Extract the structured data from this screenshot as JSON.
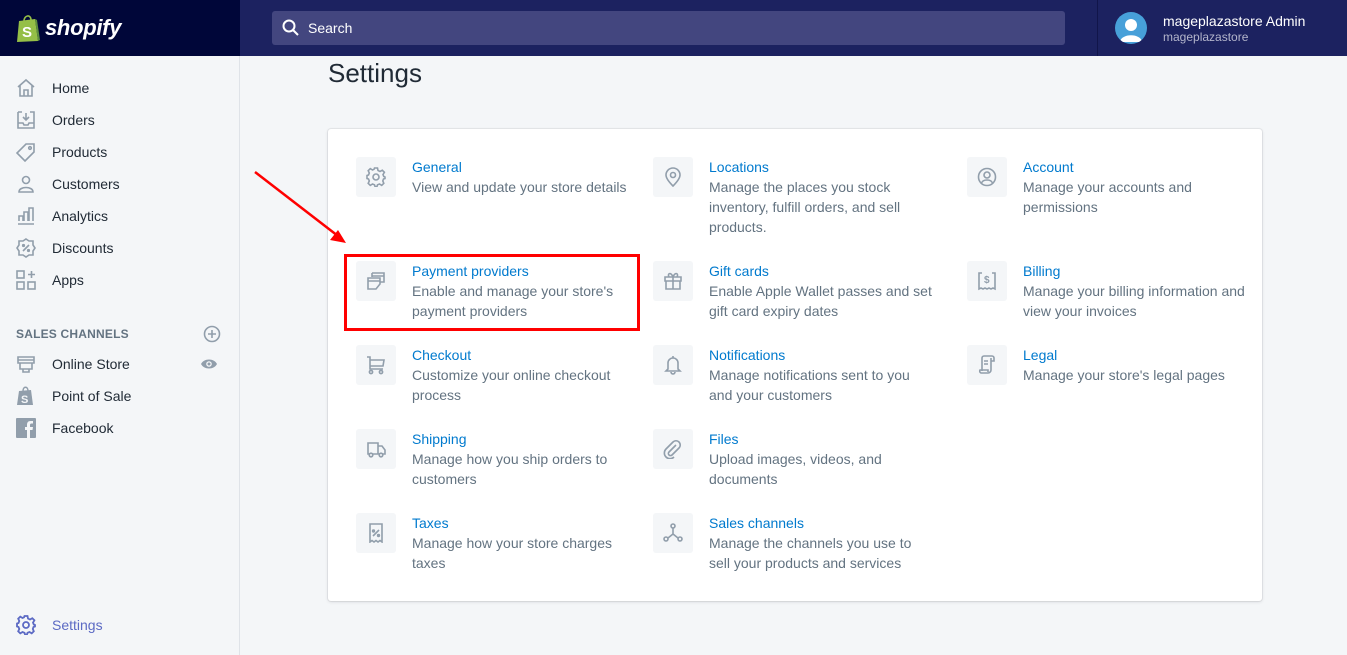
{
  "topbar": {
    "brand": "shopify",
    "search_placeholder": "Search",
    "user_name": "mageplazastore Admin",
    "store_name": "mageplazastore"
  },
  "sidebar": {
    "items": [
      {
        "label": "Home",
        "icon": "home-icon"
      },
      {
        "label": "Orders",
        "icon": "orders-icon"
      },
      {
        "label": "Products",
        "icon": "tag-icon"
      },
      {
        "label": "Customers",
        "icon": "person-icon"
      },
      {
        "label": "Analytics",
        "icon": "bar-chart-icon"
      },
      {
        "label": "Discounts",
        "icon": "discount-icon"
      },
      {
        "label": "Apps",
        "icon": "apps-icon"
      }
    ],
    "sales_channels_heading": "SALES CHANNELS",
    "channels": [
      {
        "label": "Online Store",
        "icon": "store-icon"
      },
      {
        "label": "Point of Sale",
        "icon": "shopify-bag-icon"
      },
      {
        "label": "Facebook",
        "icon": "facebook-icon"
      }
    ],
    "settings_label": "Settings"
  },
  "main": {
    "title": "Settings",
    "settings": [
      {
        "title": "General",
        "desc": "View and update your store details",
        "icon": "gear-icon"
      },
      {
        "title": "Locations",
        "desc": "Manage the places you stock inventory, fulfill orders, and sell products.",
        "icon": "location-pin-icon"
      },
      {
        "title": "Account",
        "desc": "Manage your accounts and permissions",
        "icon": "account-icon"
      },
      {
        "title": "Payment providers",
        "desc": "Enable and manage your store's payment providers",
        "icon": "payment-icon"
      },
      {
        "title": "Gift cards",
        "desc": "Enable Apple Wallet passes and set gift card expiry dates",
        "icon": "gift-icon"
      },
      {
        "title": "Billing",
        "desc": "Manage your billing information and view your invoices",
        "icon": "billing-icon"
      },
      {
        "title": "Checkout",
        "desc": "Customize your online checkout process",
        "icon": "cart-icon"
      },
      {
        "title": "Notifications",
        "desc": "Manage notifications sent to you and your customers",
        "icon": "bell-icon"
      },
      {
        "title": "Legal",
        "desc": "Manage your store's legal pages",
        "icon": "legal-scroll-icon"
      },
      {
        "title": "Shipping",
        "desc": "Manage how you ship orders to customers",
        "icon": "truck-icon"
      },
      {
        "title": "Files",
        "desc": "Upload images, videos, and documents",
        "icon": "paperclip-icon"
      },
      {
        "title": "Taxes",
        "desc": "Manage how your store charges taxes",
        "icon": "tax-receipt-icon"
      },
      {
        "title": "Sales channels",
        "desc": "Manage the channels you use to sell your products and services",
        "icon": "sales-channels-icon"
      }
    ]
  },
  "colors": {
    "topbar": "#1c2260",
    "brand_bg": "#000639",
    "link": "#007ace",
    "active_nav": "#5c6ac4",
    "annotation": "#ff0000"
  }
}
